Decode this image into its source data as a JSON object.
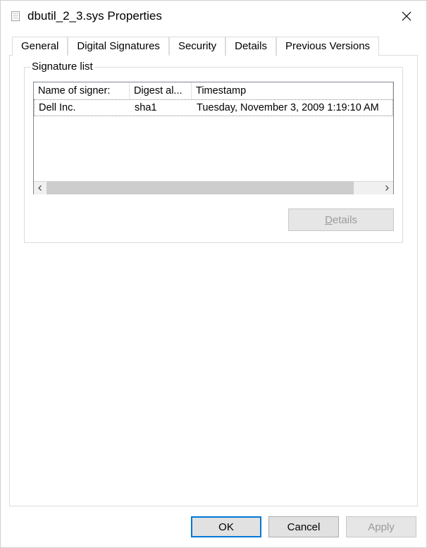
{
  "window": {
    "title": "dbutil_2_3.sys Properties"
  },
  "tabs": {
    "general": "General",
    "digital_signatures": "Digital Signatures",
    "security": "Security",
    "details": "Details",
    "previous_versions": "Previous Versions"
  },
  "group": {
    "label": "Signature list"
  },
  "columns": {
    "name": "Name of signer:",
    "digest": "Digest al...",
    "timestamp": "Timestamp"
  },
  "rows": [
    {
      "name": "Dell Inc.",
      "digest": "sha1",
      "timestamp": "Tuesday, November 3, 2009 1:19:10 AM"
    }
  ],
  "buttons": {
    "details": "Details",
    "ok": "OK",
    "cancel": "Cancel",
    "apply": "Apply"
  }
}
